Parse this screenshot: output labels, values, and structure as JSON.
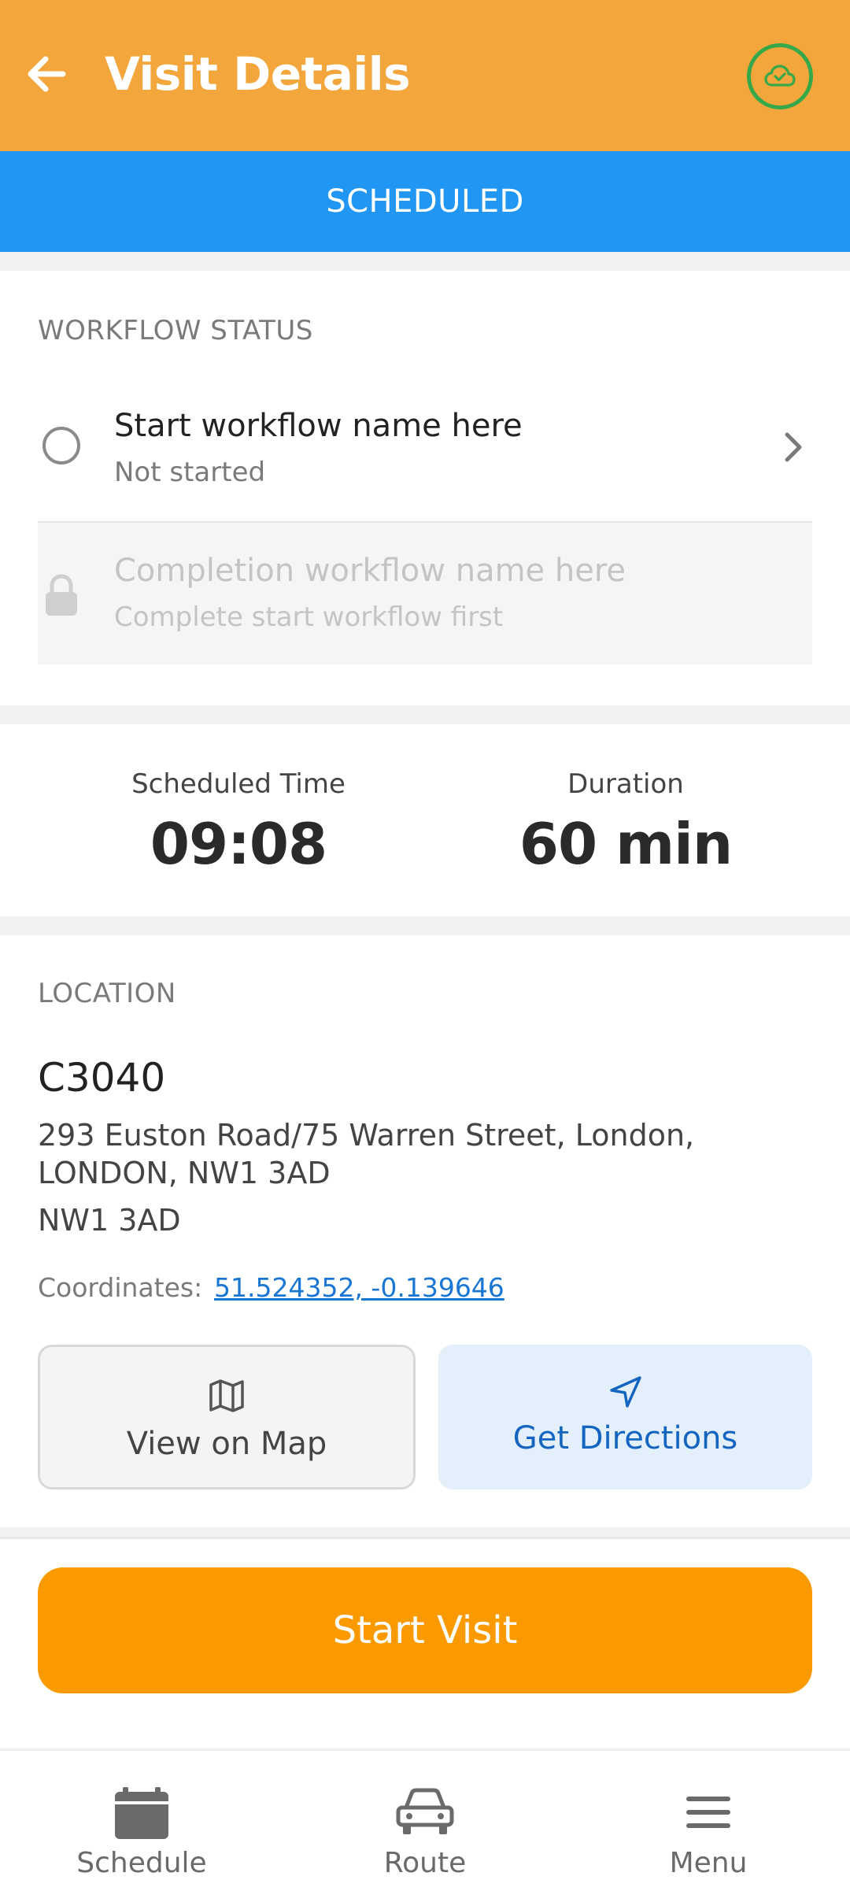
{
  "header": {
    "title": "Visit Details",
    "back_icon": "arrow-left-icon",
    "sync_icon": "cloud-check-icon",
    "sync_color": "#36a84a",
    "background": "#f2a63c"
  },
  "status_band": {
    "label": "SCHEDULED",
    "color": "#2196f3"
  },
  "workflow": {
    "section_label": "WORKFLOW STATUS",
    "start": {
      "title": "Start workflow name here",
      "status": "Not started"
    },
    "completion": {
      "title": "Completion workflow name here",
      "status": "Complete start workflow first",
      "locked": true
    }
  },
  "times": {
    "scheduled_label": "Scheduled Time",
    "scheduled_value": "09:08",
    "duration_label": "Duration",
    "duration_value": "60 min"
  },
  "location": {
    "section_label": "LOCATION",
    "code": "C3040",
    "address": "293 Euston Road/75 Warren Street, London, LONDON, NW1 3AD",
    "postcode": "NW1 3AD",
    "coordinates_label": "Coordinates:",
    "coordinates_value": "51.524352, -0.139646",
    "view_map_label": "View on Map",
    "directions_label": "Get Directions"
  },
  "actions": {
    "start_visit_label": "Start Visit",
    "accent": "#fb9a00"
  },
  "bottom_nav": {
    "items": [
      {
        "label": "Schedule",
        "icon": "calendar-icon"
      },
      {
        "label": "Route",
        "icon": "car-icon"
      },
      {
        "label": "Menu",
        "icon": "menu-icon"
      }
    ]
  }
}
